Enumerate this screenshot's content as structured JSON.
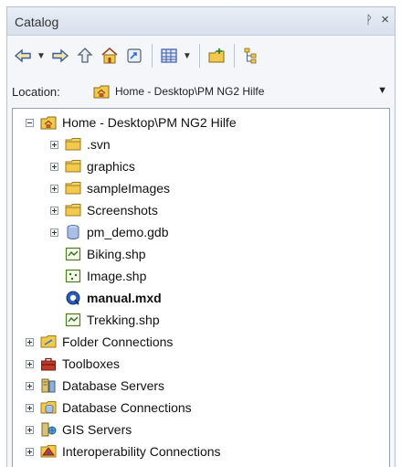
{
  "window": {
    "title": "Catalog",
    "pin_glyph": "ᚹ",
    "close_glyph": "×"
  },
  "toolbar": {
    "icons": [
      "back-arrow-icon",
      "forward-arrow-icon",
      "up-folder-icon",
      "home-folder-icon",
      "connect-folder-icon",
      "view-grid-icon",
      "new-folder-icon",
      "tree-toggle-icon"
    ]
  },
  "location": {
    "label": "Location:",
    "value": "Home - Desktop\\PM NG2 Hilfe"
  },
  "tree": {
    "root": "Home - Desktop\\PM NG2 Hilfe",
    "children": [
      ".svn",
      "graphics",
      "sampleImages",
      "Screenshots",
      "pm_demo.gdb",
      "Biking.shp",
      "Image.shp",
      "manual.mxd",
      "Trekking.shp"
    ],
    "top_level": [
      "Folder Connections",
      "Toolboxes",
      "Database Servers",
      "Database Connections",
      "GIS Servers",
      "Interoperability Connections"
    ]
  },
  "colors": {
    "folder": "#f2c94c",
    "accent": "#2f6fd1"
  }
}
